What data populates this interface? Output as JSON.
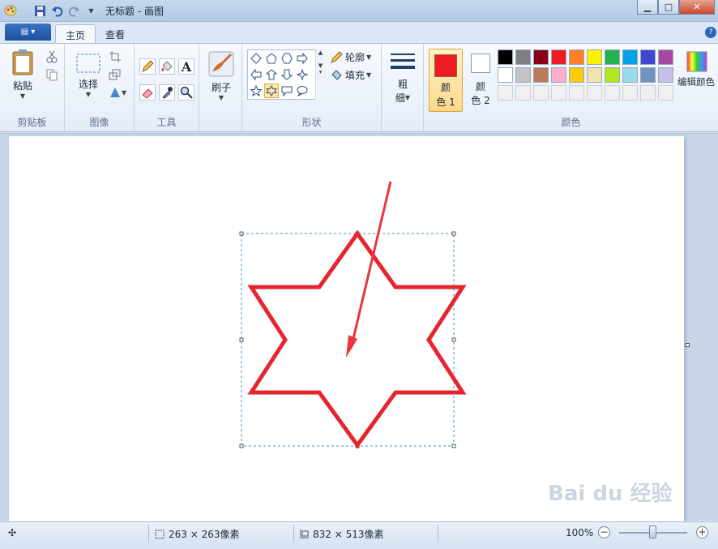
{
  "window": {
    "title": "无标题 - 画图",
    "buttons": [
      "minimize",
      "maximize",
      "close"
    ]
  },
  "tabs": {
    "file_label": "▤ ▾",
    "home": "主页",
    "view": "查看"
  },
  "ribbon": {
    "clipboard": {
      "paste": "粘贴",
      "group": "剪贴板"
    },
    "image": {
      "select": "选择",
      "group": "图像"
    },
    "tools": {
      "text_icon": "A",
      "group": "工具"
    },
    "brush": {
      "label": "刷子"
    },
    "shapes": {
      "outline": "轮廓",
      "fill": "填充",
      "group": "形状"
    },
    "size": {
      "label_1": "粗",
      "label_2": "细"
    },
    "colors": {
      "color1_line1": "颜",
      "color1_line2": "色 1",
      "color2_line1": "颜",
      "color2_line2": "色 2",
      "edit": "编辑颜色",
      "group": "颜色",
      "color1_value": "#ed1c24",
      "color2_value": "#ffffff",
      "palette_row1": [
        "#000000",
        "#7f7f7f",
        "#880015",
        "#ed1c24",
        "#ff7f27",
        "#fff200",
        "#22b14c",
        "#00a2e8",
        "#3f48cc",
        "#a349a4"
      ],
      "palette_row2": [
        "#ffffff",
        "#c3c3c3",
        "#b97a57",
        "#ffaec9",
        "#ffc90e",
        "#efe4b0",
        "#b5e61d",
        "#99d9ea",
        "#7092be",
        "#c8bfe7"
      ],
      "palette_row3": [
        "#f0f0f0",
        "#f0f0f0",
        "#f0f0f0",
        "#f0f0f0",
        "#f0f0f0",
        "#f0f0f0",
        "#f0f0f0",
        "#f0f0f0",
        "#f0f0f0",
        "#f0f0f0"
      ]
    }
  },
  "canvas": {
    "star_color": "#e3262f",
    "arrow_color": "#e8363f"
  },
  "status": {
    "selection_size": "263 × 263像素",
    "canvas_size": "832 × 513像素",
    "zoom": "100%"
  },
  "watermark": "Bai du 经验"
}
